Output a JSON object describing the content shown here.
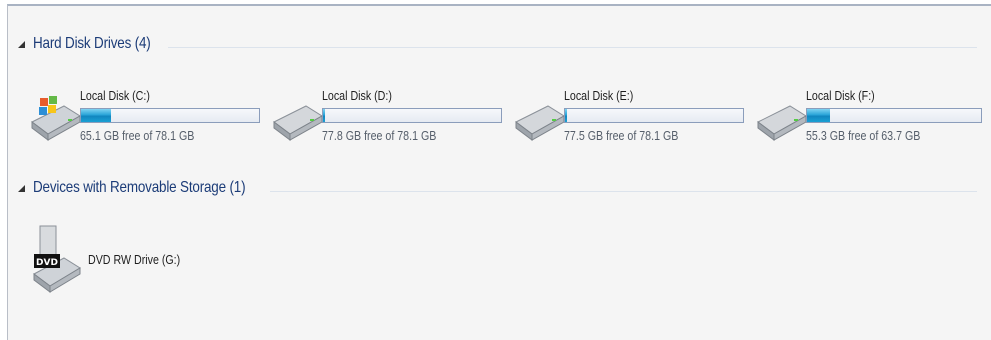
{
  "groups": [
    {
      "title": "Hard Disk Drives (4)",
      "drives": [
        {
          "name": "Local Disk (C:)",
          "free_text": "65.1 GB free of 78.1 GB",
          "used_fraction": 0.17,
          "icon": "windows-drive-icon"
        },
        {
          "name": "Local Disk (D:)",
          "free_text": "77.8 GB free of 78.1 GB",
          "used_fraction": 0.004,
          "icon": "hard-disk-icon"
        },
        {
          "name": "Local Disk (E:)",
          "free_text": "77.5 GB free of 78.1 GB",
          "used_fraction": 0.008,
          "icon": "hard-disk-icon"
        },
        {
          "name": "Local Disk (F:)",
          "free_text": "55.3 GB free of 63.7 GB",
          "used_fraction": 0.13,
          "icon": "hard-disk-icon"
        }
      ]
    },
    {
      "title": "Devices with Removable Storage (1)",
      "devices": [
        {
          "name": "DVD RW Drive (G:)",
          "icon": "dvd-drive-icon",
          "badge": "DVD"
        }
      ]
    }
  ],
  "colors": {
    "group_title": "#1c3c78",
    "bar_fill": "#1a9bd3",
    "frame_bg": "#f5f5f5"
  }
}
